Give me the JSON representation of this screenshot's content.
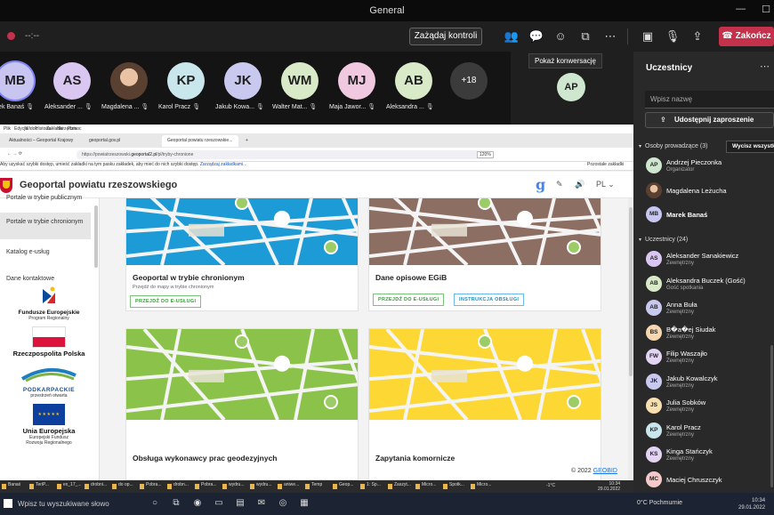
{
  "window": {
    "title": "General"
  },
  "toolbar": {
    "timer": "--:--",
    "request_control": "Zażądaj kontroli",
    "end_call": "Zakończ"
  },
  "stage": {
    "participants": [
      {
        "initials": "MB",
        "name": "Marek Banaś",
        "color": "#c8c6f0"
      },
      {
        "initials": "AS",
        "name": "Aleksander ...",
        "color": "#d9c7f2"
      },
      {
        "initials": "",
        "name": "Magdalena ...",
        "color": "#8a6a55"
      },
      {
        "initials": "KP",
        "name": "Karol Pracz",
        "color": "#c9e6ec"
      },
      {
        "initials": "JK",
        "name": "Jakub Kowa...",
        "color": "#c9c9ef"
      },
      {
        "initials": "WM",
        "name": "Walter Mat...",
        "color": "#d8eac7"
      },
      {
        "initials": "MJ",
        "name": "Maja Jawor...",
        "color": "#f0c8e0"
      },
      {
        "initials": "AB",
        "name": "Aleksandra ...",
        "color": "#d8eac7"
      }
    ],
    "overflow_count": "+18",
    "overflow_avatar": "AP",
    "tooltip": "Pokaż konwersację"
  },
  "browser": {
    "menu": [
      "Plik",
      "Edycja",
      "Widok",
      "Historia",
      "Zakładki",
      "Narzędzia",
      "Pomoc"
    ],
    "tabs": [
      "Aktualności – Geoportal Krajowy",
      "geoportal.gov.pl",
      "Geoportal powiatu rzeszowskie..."
    ],
    "url_prefix": "https://powiatrzeszowski.",
    "url_host": "geoportal2.pl",
    "url_path": "/pl/tryby-chronione",
    "zoom": "120%",
    "infobar": "Aby uzyskać szybki dostęp, umieść zakładki na tym pasku zakładek, aby mieć do nich szybki dostęp.",
    "infobar_link": "Zarządzaj zakładkami...",
    "bookmarks_other": "Pozostałe zakładki",
    "site_title": "Geoportal powiatu rzeszowskiego",
    "site_g": "g",
    "lang": "PL",
    "sidebar": [
      "Portale w trybie publicznym",
      "Portale w trybie chronionym",
      "Katalog e-usług",
      "Dane kontaktowe"
    ],
    "logos": {
      "eu_funds_label": "Fundusze Europejskie",
      "eu_funds_sub": "Program Regionalny",
      "poland": "Rzeczpospolita Polska",
      "podkarpackie": "PODKARPACKIE",
      "podkarpackie_sub": "przestrzeń otwarta",
      "eu_label": "Unia Europejska",
      "eu_sub1": "Europejski Fundusz",
      "eu_sub2": "Rozwoju Regionalnego"
    },
    "cards": [
      {
        "title": "Geoportal w trybie chronionym",
        "subtitle": "Przejdź do mapy w trybie chronionym",
        "buttons": [
          "PRZEJDŹ DO E-USŁUGI"
        ],
        "color": "#1d9bd7",
        "road": "#f4f4f4"
      },
      {
        "title": "Dane opisowe EGiB",
        "subtitle": "",
        "buttons": [
          "PRZEJDŹ DO E-USŁUGI",
          "INSTRUKCJA OBSŁUGI"
        ],
        "color": "#8d6e63",
        "road": "#f4f4f4"
      },
      {
        "title": "Obsługa wykonawcy prac geodezyjnych",
        "subtitle": "",
        "buttons": [],
        "color": "#8bc34a",
        "road": "#f4f4f4"
      },
      {
        "title": "Zapytania komornicze",
        "subtitle": "",
        "buttons": [],
        "color": "#fdd835",
        "road": "#f4f4f4"
      }
    ],
    "footer_text": "© 2022",
    "footer_link": "GEOBID"
  },
  "subtaskbar": {
    "items": [
      "Banaś",
      "TeriP...",
      "ex_17_...",
      "drobni...",
      "do op...",
      "Pobra...",
      "drobn...",
      "Pobra...",
      "wydru...",
      "wydru...",
      "aniwe...",
      "Temp",
      "Geop...",
      "1: Sp...",
      "Zaszyt...",
      "Micro...",
      "Spotk...",
      "Micro..."
    ],
    "temp": "-1°C",
    "time": "10:34",
    "date": "29.01.2022"
  },
  "panel": {
    "title": "Uczestnicy",
    "search_placeholder": "Wpisz nazwę",
    "share": "Udostępnij zaproszenie",
    "organizers_section": "Osoby prowadzące (3)",
    "mute_all": "Wycisz wszystkich",
    "organizers": [
      {
        "initials": "AP",
        "name": "Andrzej Pieczonka",
        "role": "Organizator",
        "color": "#cfe6cf"
      },
      {
        "initials": "",
        "name": "Magdalena Leżucha",
        "role": "",
        "color": "#8a6a55"
      },
      {
        "initials": "MB",
        "name": "Marek Banaś",
        "role": "",
        "color": "#c8c6f0"
      }
    ],
    "attendees_section": "Uczestnicy (24)",
    "attendees": [
      {
        "initials": "AS",
        "name": "Aleksander Sanakiewicz",
        "role": "Zewnętrzny",
        "color": "#d9c7f2"
      },
      {
        "initials": "AB",
        "name": "Aleksandra Buczek (Gość)",
        "role": "Gość spotkania",
        "color": "#d8eac7"
      },
      {
        "initials": "AB",
        "name": "Anna Buła",
        "role": "Zewnętrzny",
        "color": "#c9c9ef"
      },
      {
        "initials": "BS",
        "name": "B�a�ej Siudak",
        "role": "Zewnętrzny",
        "color": "#f6d7b0"
      },
      {
        "initials": "FW",
        "name": "Filip Waszajło",
        "role": "Zewnętrzny",
        "color": "#e4d4f4"
      },
      {
        "initials": "JK",
        "name": "Jakub Kowalczyk",
        "role": "Zewnętrzny",
        "color": "#c9c9ef"
      },
      {
        "initials": "JS",
        "name": "Julia Sobków",
        "role": "Zewnętrzny",
        "color": "#f6e0b0"
      },
      {
        "initials": "KP",
        "name": "Karol Pracz",
        "role": "Zewnętrzny",
        "color": "#c9e6ec"
      },
      {
        "initials": "KS",
        "name": "Kinga Stańczyk",
        "role": "Zewnętrzny",
        "color": "#e4d4f4"
      },
      {
        "initials": "MC",
        "name": "Maciej Chruszczyk",
        "role": "",
        "color": "#f4c9c9"
      }
    ]
  },
  "taskbar": {
    "search": "Wpisz tu wyszukiwane słowo",
    "weather": "0°C  Pochmurnie",
    "time": "10:34",
    "date": "29.01.2022"
  }
}
